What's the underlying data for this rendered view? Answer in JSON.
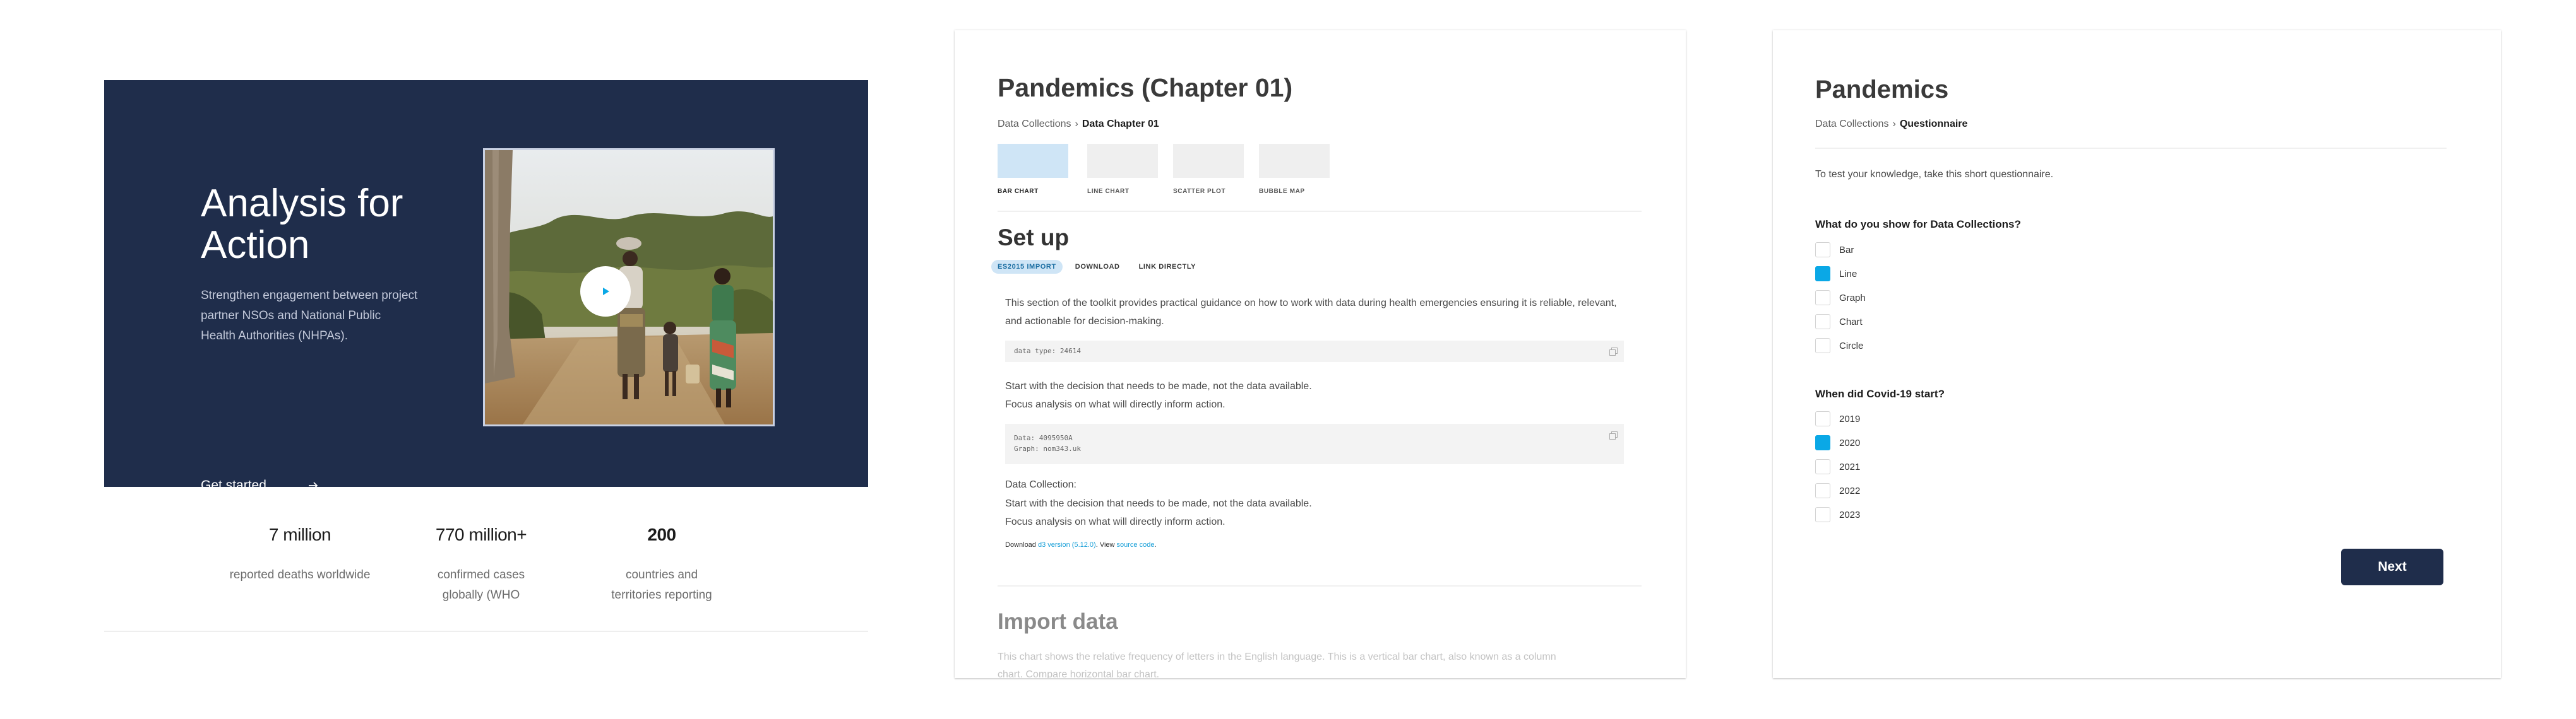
{
  "hero": {
    "title": "Analysis for Action",
    "subtitle": "Strengthen engagement between project partner NSOs and National Public Health Authorities (NHPAs).",
    "cta": "Get started"
  },
  "stats": [
    {
      "value": "7 million",
      "label": "reported deaths worldwide"
    },
    {
      "value": "770 million+",
      "label": "confirmed cases globally (WHO"
    },
    {
      "value": "200",
      "label": "countries and territories reporting"
    }
  ],
  "chapter": {
    "title": "Pandemics (Chapter 01)",
    "breadcrumb": {
      "root": "Data Collections",
      "sep": "›",
      "current": "Data Chapter 01"
    },
    "chart_types": [
      "BAR CHART",
      "LINE CHART",
      "SCATTER PLOT",
      "BUBBLE MAP"
    ],
    "setup_title": "Set up",
    "tabs": [
      "ES2015 IMPORT",
      "DOWNLOAD",
      "LINK DIRECTLY"
    ],
    "intro": "This section of the toolkit provides practical guidance on how to work with data during health emergencies ensuring it is reliable, relevant, and actionable for decision-making.",
    "code1": "data type: 24614",
    "para1_line1": "Start with the decision that needs to be made, not the data available.",
    "para1_line2": "Focus analysis on what will directly inform action.",
    "code2_line1": "Data: 4095950A",
    "code2_line2": "Graph: nom343.uk",
    "collection_label": "Data Collection:",
    "para2_line1": "Start with the decision that needs to be made, not the data available.",
    "para2_line2": "Focus analysis on what will directly inform action.",
    "download_prefix": "Download ",
    "download_link": "d3 version (5.12.0)",
    "download_mid": ". View ",
    "source_link": "source code",
    "download_suffix": ".",
    "import_title": "Import data",
    "import_text": "This chart shows the relative frequency of letters in the English language. This is a vertical bar chart, also known as a column chart. Compare horizontal bar chart."
  },
  "quiz": {
    "title": "Pandemics",
    "breadcrumb": {
      "root": "Data Collections",
      "sep": "›",
      "current": "Questionnaire"
    },
    "intro": "To test your knowledge, take this short questionnaire.",
    "q1": {
      "question": "What do you show for Data Collections?",
      "options": [
        "Bar",
        "Line",
        "Graph",
        "Chart",
        "Circle"
      ],
      "checked": [
        false,
        true,
        false,
        false,
        false
      ]
    },
    "q2": {
      "question": "When did Covid-19 start?",
      "options": [
        "2019",
        "2020",
        "2021",
        "2022",
        "2023"
      ],
      "checked": [
        false,
        true,
        false,
        false,
        false
      ]
    },
    "next": "Next"
  },
  "colors": {
    "navy": "#1f2d4b",
    "accent": "#0aa8e6",
    "tab_active_bg": "#cfe5f6"
  },
  "icons": [
    "play-icon",
    "arrow-right-icon",
    "copy-icon",
    "check-icon"
  ]
}
